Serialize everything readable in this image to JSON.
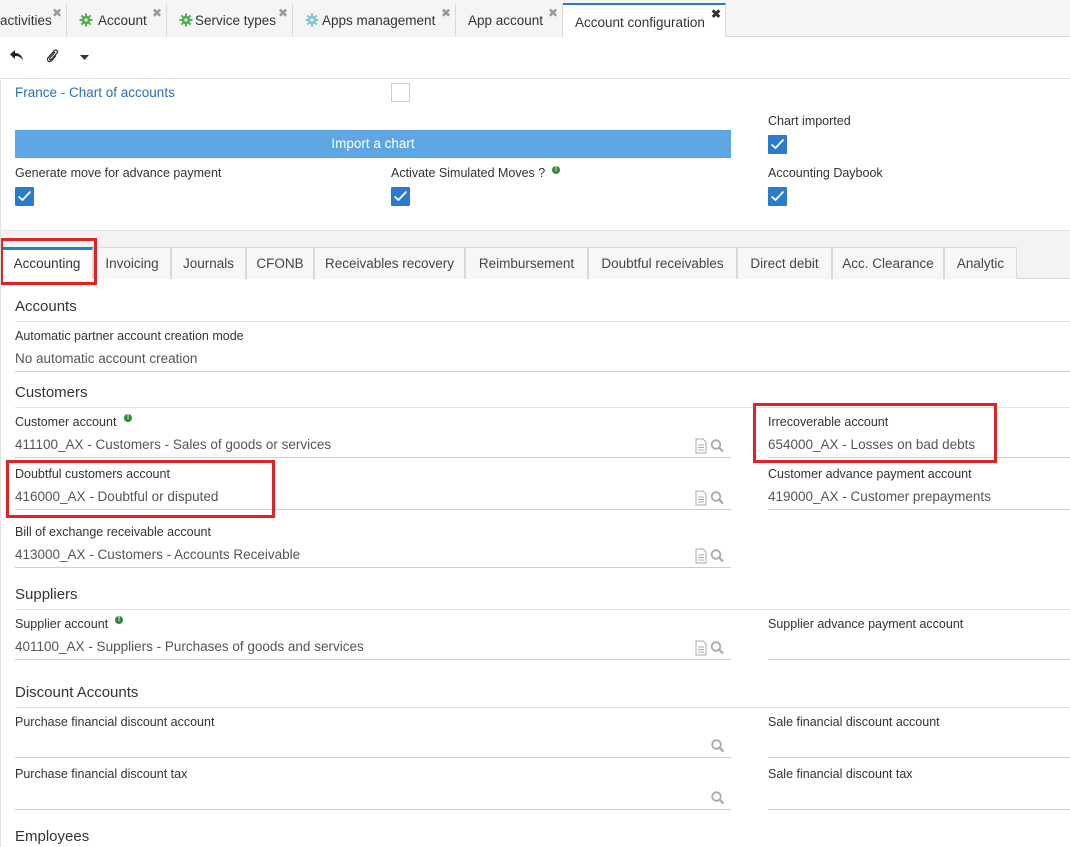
{
  "tabs": [
    {
      "label": "activities",
      "icon": "none",
      "closable": true
    },
    {
      "label": "Account",
      "icon": "gear-icon",
      "closable": true
    },
    {
      "label": "Service types",
      "icon": "gear-icon",
      "closable": true
    },
    {
      "label": "Apps management",
      "icon": "gear-icon",
      "closable": true
    },
    {
      "label": "App account",
      "icon": "none",
      "closable": true
    },
    {
      "label": "Account configuration",
      "icon": "none",
      "closable": true,
      "active": true
    }
  ],
  "close_glyph": "✖",
  "toolbar": {
    "back_icon": "undo-icon",
    "attach_icon": "paperclip-icon",
    "dropdown_icon": "caret-down-icon"
  },
  "header": {
    "chart_link": "France - Chart of accounts",
    "import_button": "Import a chart",
    "chart_imported_label": "Chart imported",
    "chart_imported_checked": true,
    "advance_payment_label": "Generate move for advance payment",
    "advance_payment_checked": true,
    "simulated_label": "Activate Simulated Moves ?",
    "simulated_checked": true,
    "daybook_label": "Accounting Daybook",
    "daybook_checked": true,
    "info_glyph": "!"
  },
  "inner_tabs": [
    "Accounting",
    "Invoicing",
    "Journals",
    "CFONB",
    "Receivables recovery",
    "Reimbursement",
    "Doubtful receivables",
    "Direct debit",
    "Acc. Clearance",
    "Analytic"
  ],
  "accounts": {
    "heading": "Accounts",
    "auto_mode_label": "Automatic partner account creation mode",
    "auto_mode_value": "No automatic account creation"
  },
  "customers": {
    "heading": "Customers",
    "customer_account_label": "Customer account",
    "customer_account_value": "411100_AX - Customers - Sales of goods or services",
    "irrecoverable_label": "Irrecoverable account",
    "irrecoverable_value": "654000_AX - Losses on bad debts",
    "doubtful_label": "Doubtful customers account",
    "doubtful_value": "416000_AX - Doubtful or disputed",
    "advance_label": "Customer advance payment account",
    "advance_value": "419000_AX - Customer prepayments",
    "bill_label": "Bill of exchange receivable account",
    "bill_value": "413000_AX - Customers - Accounts Receivable"
  },
  "suppliers": {
    "heading": "Suppliers",
    "supplier_label": "Supplier account",
    "supplier_value": "401100_AX - Suppliers - Purchases of goods and services",
    "supplier_advance_label": "Supplier advance payment account",
    "supplier_advance_value": ""
  },
  "discount": {
    "heading": "Discount Accounts",
    "purchase_label": "Purchase financial discount account",
    "sale_label": "Sale financial discount account",
    "purchase_tax_label": "Purchase financial discount tax",
    "sale_tax_label": "Sale financial discount tax"
  },
  "employees": {
    "heading": "Employees"
  },
  "colors": {
    "accent": "#2a7bc9",
    "highlight": "#e02323",
    "import_button": "#5ea6e3",
    "link": "#2a6fb5"
  }
}
